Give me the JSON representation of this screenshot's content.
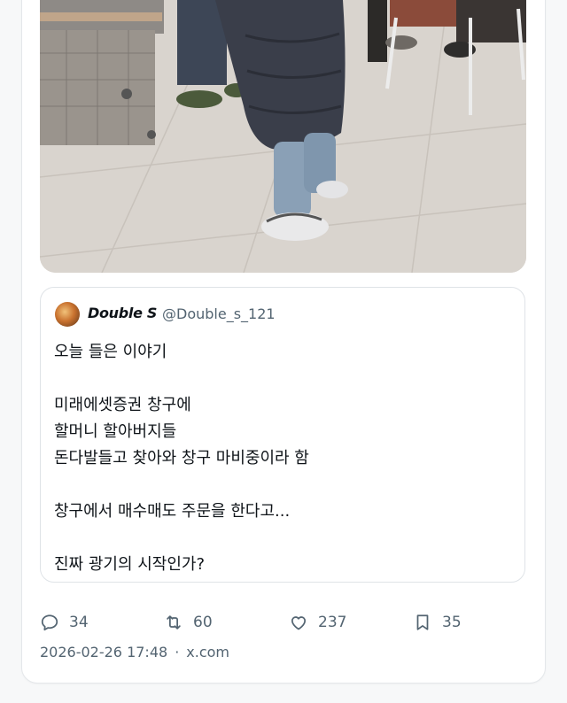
{
  "quoted_tweet": {
    "author_name": "Double S",
    "author_handle": "@Double_s_121",
    "text": "오늘 들은 이야기\n\n미래에셋증권 창구에\n할머니 할아버지들\n돈다발들고 찾아와 창구 마비중이라 함\n\n창구에서 매수매도 주문을 한다고...\n\n진짜 광기의 시작인가?"
  },
  "actions": {
    "replies": "34",
    "retweets": "60",
    "likes": "237",
    "bookmarks": "35"
  },
  "meta": {
    "date": "2026-02-26 17:48",
    "separator": "·",
    "source": "x.com"
  },
  "colors": {
    "text_primary": "#0f1419",
    "text_secondary": "#536471",
    "border": "#dfe3e7"
  }
}
